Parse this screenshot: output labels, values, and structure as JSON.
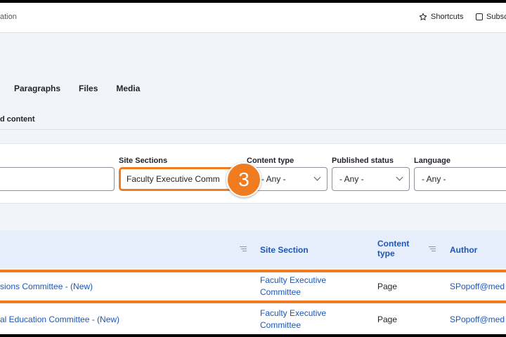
{
  "toolbar": {
    "crumb": "ation",
    "shortcuts_label": "Shortcuts",
    "subscribe_label": "Subsc"
  },
  "tabs": [
    "Paragraphs",
    "Files",
    "Media"
  ],
  "subtab": "d content",
  "filters": {
    "site_sections": {
      "label": "Site Sections",
      "value": "Faculty Executive Comm"
    },
    "content_type": {
      "label": "Content type",
      "value": "- Any -"
    },
    "published_status": {
      "label": "Published status",
      "value": "- Any -"
    },
    "language": {
      "label": "Language",
      "value": "- Any -"
    }
  },
  "step_badge": "3",
  "table": {
    "headers": {
      "site_section": "Site Section",
      "content_type": "Content type",
      "author": "Author"
    },
    "rows": [
      {
        "title": "sions Committee - (New)",
        "site_section": "Faculty Executive Committee",
        "content_type": "Page",
        "author": "SPopoff@med"
      },
      {
        "title": "al Education Committee - (New)",
        "site_section": "Faculty Executive Committee",
        "content_type": "Page",
        "author": "SPopoff@med"
      }
    ]
  },
  "colors": {
    "accent": "#f07c22",
    "link": "#1c57b7",
    "header_bg": "#e6edfb"
  }
}
